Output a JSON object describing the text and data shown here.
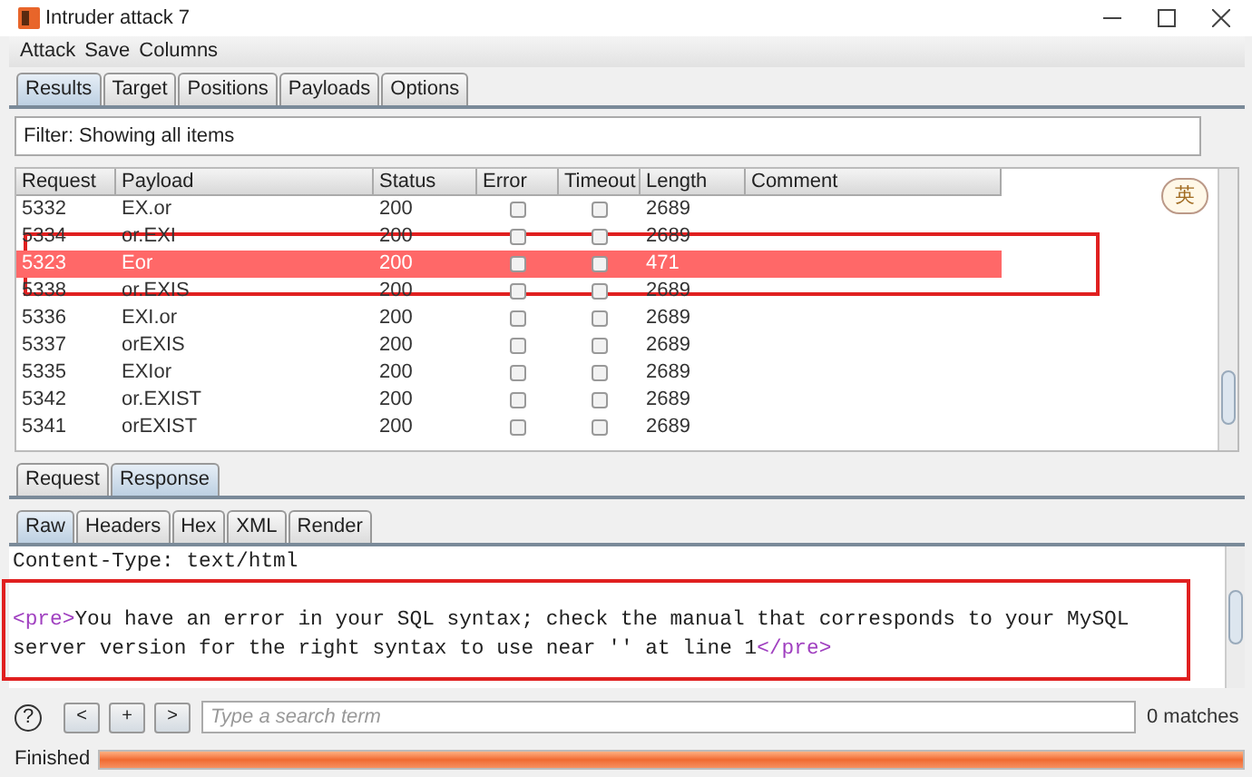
{
  "window": {
    "title": "Intruder attack 7"
  },
  "menu": [
    "Attack",
    "Save",
    "Columns"
  ],
  "tabs": [
    {
      "label": "Results",
      "selected": true
    },
    {
      "label": "Target",
      "selected": false
    },
    {
      "label": "Positions",
      "selected": false
    },
    {
      "label": "Payloads",
      "selected": false
    },
    {
      "label": "Options",
      "selected": false
    }
  ],
  "filter": "Filter: Showing all items",
  "ime_badge": "英",
  "table": {
    "columns": [
      "Request",
      "Payload",
      "Status",
      "Error",
      "Timeout",
      "Length",
      "Comment"
    ],
    "rows": [
      {
        "request": "5332",
        "payload": "EX.or",
        "status": "200",
        "error": false,
        "timeout": false,
        "length": "2689",
        "selected": false
      },
      {
        "request": "5334",
        "payload": "or.EXI",
        "status": "200",
        "error": false,
        "timeout": false,
        "length": "2689",
        "selected": false
      },
      {
        "request": "5323",
        "payload": "Eor",
        "status": "200",
        "error": false,
        "timeout": false,
        "length": "471",
        "selected": true
      },
      {
        "request": "5338",
        "payload": "or.EXIS",
        "status": "200",
        "error": false,
        "timeout": false,
        "length": "2689",
        "selected": false
      },
      {
        "request": "5336",
        "payload": "EXI.or",
        "status": "200",
        "error": false,
        "timeout": false,
        "length": "2689",
        "selected": false
      },
      {
        "request": "5337",
        "payload": "orEXIS",
        "status": "200",
        "error": false,
        "timeout": false,
        "length": "2689",
        "selected": false
      },
      {
        "request": "5335",
        "payload": "EXIor",
        "status": "200",
        "error": false,
        "timeout": false,
        "length": "2689",
        "selected": false
      },
      {
        "request": "5342",
        "payload": "or.EXIST",
        "status": "200",
        "error": false,
        "timeout": false,
        "length": "2689",
        "selected": false
      },
      {
        "request": "5341",
        "payload": "orEXIST",
        "status": "200",
        "error": false,
        "timeout": false,
        "length": "2689",
        "selected": false
      }
    ]
  },
  "message_tabs": [
    {
      "label": "Request",
      "selected": false
    },
    {
      "label": "Response",
      "selected": true
    }
  ],
  "view_tabs": [
    {
      "label": "Raw",
      "selected": true
    },
    {
      "label": "Headers",
      "selected": false
    },
    {
      "label": "Hex",
      "selected": false
    },
    {
      "label": "XML",
      "selected": false
    },
    {
      "label": "Render",
      "selected": false
    }
  ],
  "response_lines": [
    [
      {
        "kind": "text",
        "text": "Content-Type: text/html"
      }
    ],
    [
      {
        "kind": "tag",
        "text": "<pre>"
      },
      {
        "kind": "text",
        "text": "You have an error in your SQL syntax; check the manual that corresponds to your MySQL"
      }
    ],
    [
      {
        "kind": "text",
        "text": "server version for the right syntax to use near '' at line 1"
      },
      {
        "kind": "tag",
        "text": "</pre>"
      }
    ]
  ],
  "search": {
    "help": "?",
    "buttons": [
      "<",
      "+",
      ">"
    ],
    "placeholder": "Type a search term",
    "matches": "0 matches"
  },
  "status": {
    "label": "Finished",
    "level": 1
  }
}
